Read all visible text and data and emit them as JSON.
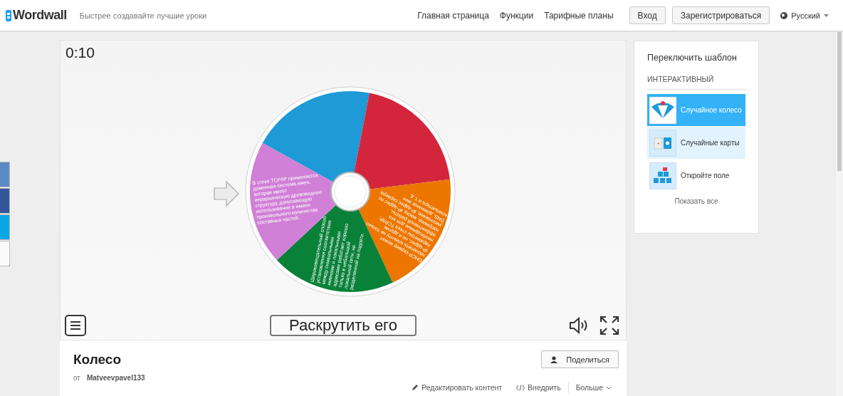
{
  "header": {
    "logo": "Wordwall",
    "tagline": "Быстрее создавайте лучшие уроки",
    "nav": [
      "Главная страница",
      "Функции",
      "Тарифные планы"
    ],
    "login_button": "Вход",
    "register_button": "Зарегистрироваться",
    "language": "Русский"
  },
  "game": {
    "timer": "0:10",
    "wheel_segments": [
      {
        "color": "#1e9ad6"
      },
      {
        "color": "#d3263d"
      },
      {
        "color": "#ec7600",
        "text": "DHCP-сервер может назначить клиенту не только IP-адрес, но и другие параметры стека TCP/IP, необходимые для его эффективной работы, например, маску, IP-адрес по умолчанию, IP-адрес сервера DNS, доменное имя компьютера и т. д."
      },
      {
        "color": "#0a8139",
        "text": "Широковещательный способ установления соответствия между символьными именами и локальными адресами работает хорошо только в небольшой локальной сети, не разделенной на подсети."
      },
      {
        "color": "#d080d6",
        "text": "В стеке TCP/IP применяется доменная система имен, которая имеет иерархическую древовидную структуру, допускающую использование в имени произвольного количества составных частей."
      }
    ],
    "spin_button": "Раскрутить его"
  },
  "info": {
    "title": "Колесо",
    "author_prefix": "от",
    "author": "Matveevpavel133",
    "share_button": "Поделиться",
    "actions": [
      {
        "kind": "edit",
        "label": "Редактировать контент"
      },
      {
        "kind": "embed",
        "label": "Внедрить"
      },
      {
        "kind": "more",
        "label": "Больше"
      }
    ]
  },
  "sidebar": {
    "title": "Переключить шаблон",
    "section": "ИНТЕРАКТИВНЫЙ",
    "templates": [
      {
        "kind": "wheel",
        "label": "Случайное колесо",
        "selected": true,
        "highlighted": false
      },
      {
        "kind": "cards",
        "label": "Случайные карты",
        "selected": false,
        "highlighted": true
      },
      {
        "kind": "boxes",
        "label": "Откройте поле",
        "selected": false,
        "highlighted": false
      }
    ],
    "show_all": "Показать все"
  }
}
